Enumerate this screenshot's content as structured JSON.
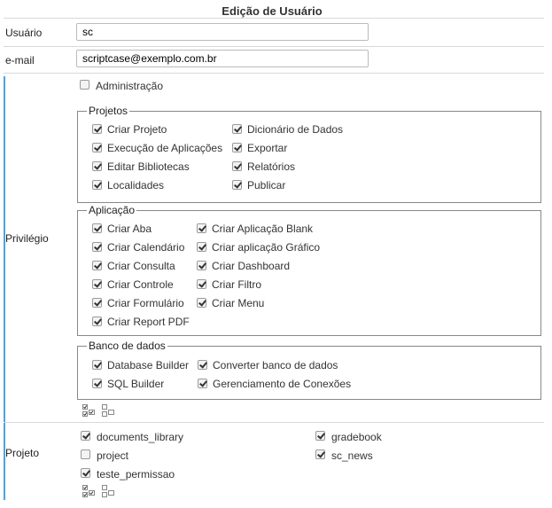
{
  "title": "Edição de Usuário",
  "usuario": {
    "label": "Usuário",
    "value": "sc"
  },
  "email": {
    "label": "e-mail",
    "value": "scriptcase@exemplo.com.br"
  },
  "privilegio": {
    "label": "Privilégio",
    "administracao": {
      "label": "Administração",
      "checked": false
    },
    "projetos": {
      "legend": "Projetos",
      "items": [
        {
          "label": "Criar Projeto",
          "checked": true
        },
        {
          "label": "Dicionário de Dados",
          "checked": true
        },
        {
          "label": "Execução de Aplicações",
          "checked": true
        },
        {
          "label": "Exportar",
          "checked": true
        },
        {
          "label": "Editar Bibliotecas",
          "checked": true
        },
        {
          "label": "Relatórios",
          "checked": true
        },
        {
          "label": "Localidades",
          "checked": true
        },
        {
          "label": "Publicar",
          "checked": true
        }
      ]
    },
    "aplicacao": {
      "legend": "Aplicação",
      "items": [
        {
          "label": "Criar Aba",
          "checked": true
        },
        {
          "label": "Criar Aplicação Blank",
          "checked": true
        },
        {
          "label": "Criar Calendário",
          "checked": true
        },
        {
          "label": "Criar aplicação Gráfico",
          "checked": true
        },
        {
          "label": "Criar Consulta",
          "checked": true
        },
        {
          "label": "Criar Dashboard",
          "checked": true
        },
        {
          "label": "Criar Controle",
          "checked": true
        },
        {
          "label": "Criar Filtro",
          "checked": true
        },
        {
          "label": "Criar Formulário",
          "checked": true
        },
        {
          "label": "Criar Menu",
          "checked": true
        },
        {
          "label": "Criar Report PDF",
          "checked": true
        }
      ]
    },
    "banco": {
      "legend": "Banco de dados",
      "items": [
        {
          "label": "Database Builder",
          "checked": true
        },
        {
          "label": "Converter banco de dados",
          "checked": true
        },
        {
          "label": "SQL Builder",
          "checked": true
        },
        {
          "label": "Gerenciamento de Conexões",
          "checked": true
        }
      ]
    },
    "icons": [
      "select-all-icon",
      "deselect-all-icon"
    ]
  },
  "projeto": {
    "label": "Projeto",
    "items": [
      {
        "label": "documents_library",
        "checked": true
      },
      {
        "label": "gradebook",
        "checked": true
      },
      {
        "label": "project",
        "checked": false
      },
      {
        "label": "sc_news",
        "checked": true
      },
      {
        "label": "teste_permissao",
        "checked": true
      }
    ],
    "icons": [
      "select-all-icon",
      "deselect-all-icon"
    ]
  },
  "colors": {
    "accent": "#4da3e0",
    "border": "#888888",
    "divider": "#d9d9d9"
  }
}
